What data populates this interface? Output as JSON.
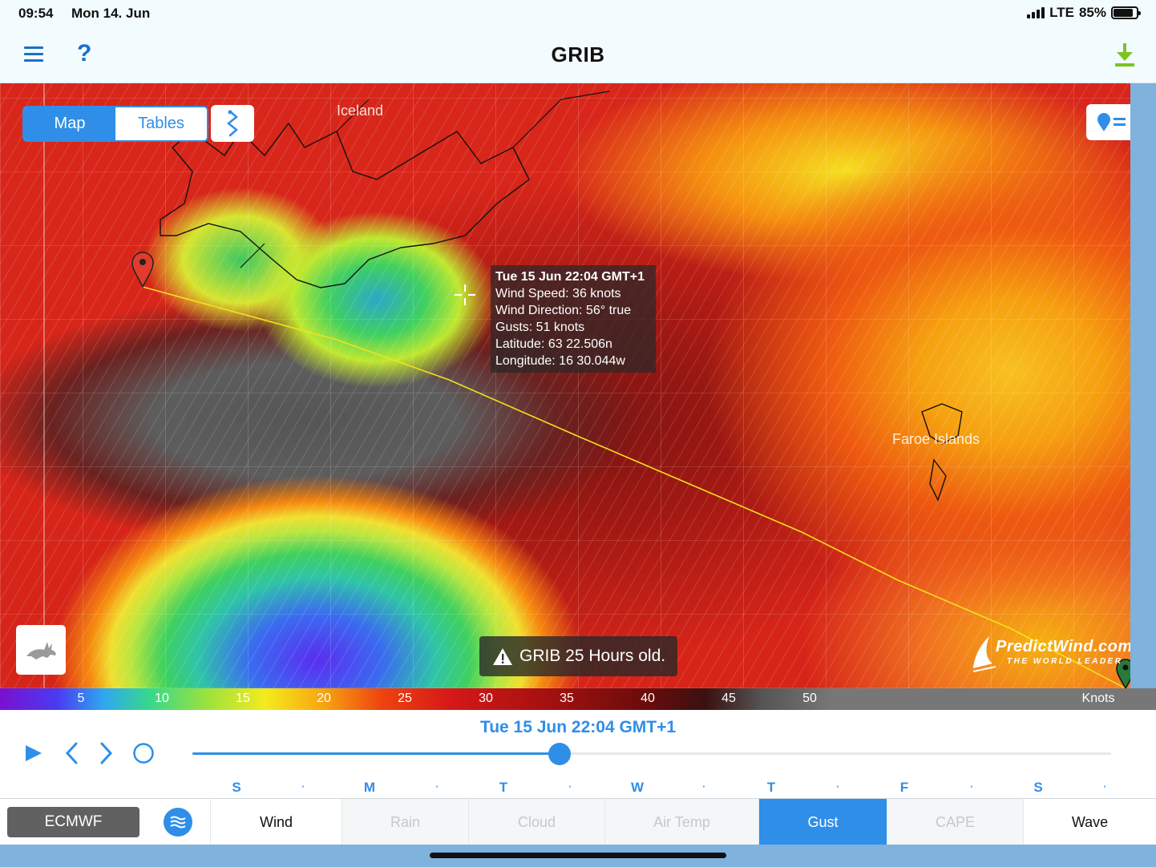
{
  "status_bar": {
    "time": "09:54",
    "date": "Mon 14. Jun",
    "network": "LTE",
    "battery": "85%",
    "battery_level": 0.85
  },
  "nav": {
    "title": "GRIB",
    "left_icons": [
      "menu-icon",
      "help-icon"
    ],
    "help_glyph": "?",
    "right_icon": "download-icon"
  },
  "view_toggle": {
    "map": "Map",
    "tables": "Tables",
    "selected": "Map"
  },
  "map": {
    "labels": {
      "iceland": "Iceland",
      "faroe": "Faroe Islands"
    },
    "tooltip": {
      "title": "Tue 15 Jun 22:04 GMT+1",
      "wind_speed": "Wind Speed: 36 knots",
      "wind_direction": "Wind Direction: 56° true",
      "gusts": "Gusts: 51 knots",
      "latitude": "Latitude: 63 22.506n",
      "longitude": "Longitude: 16 30.044w"
    },
    "warning": "GRIB 25 Hours old.",
    "brand": {
      "name": "PredictWind.com",
      "tagline": "THE WORLD LEADER"
    },
    "colors": {
      "route_line": "#f2e21a",
      "start_marker": "#e23b2e",
      "end_marker": "#2a7a3a"
    }
  },
  "scale": {
    "ticks": [
      "5",
      "10",
      "15",
      "20",
      "25",
      "30",
      "35",
      "40",
      "45",
      "50"
    ],
    "unit": "Knots"
  },
  "timeline": {
    "current": "Tue 15 Jun 22:04 GMT+1",
    "progress": 0.4,
    "days": [
      "S",
      "M",
      "T",
      "W",
      "T",
      "F",
      "S"
    ],
    "separator": "·"
  },
  "bottom_bar": {
    "model": "ECMWF",
    "tabs": [
      {
        "label": "Wind",
        "state": "enabled"
      },
      {
        "label": "Rain",
        "state": "disabled"
      },
      {
        "label": "Cloud",
        "state": "disabled"
      },
      {
        "label": "Air Temp",
        "state": "disabled"
      },
      {
        "label": "Gust",
        "state": "selected"
      },
      {
        "label": "CAPE",
        "state": "disabled"
      },
      {
        "label": "Wave",
        "state": "enabled"
      }
    ]
  },
  "accent": "#2f8ee8"
}
